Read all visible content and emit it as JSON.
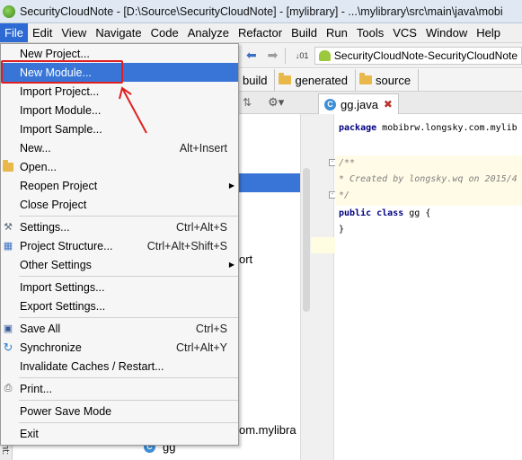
{
  "window": {
    "title": "SecurityCloudNote - [D:\\Source\\SecurityCloudNote] - [mylibrary] - ...\\mylibrary\\src\\main\\java\\mobi"
  },
  "menubar": {
    "items": [
      "File",
      "Edit",
      "View",
      "Navigate",
      "Code",
      "Analyze",
      "Refactor",
      "Build",
      "Run",
      "Tools",
      "VCS",
      "Window",
      "Help"
    ],
    "active": "File"
  },
  "toolbar": {
    "run_config": "SecurityCloudNote-SecurityCloudNote",
    "icons": [
      "back-arrow-icon",
      "forward-arrow-icon",
      "binary-icon",
      "android-icon"
    ]
  },
  "breadcrumb": {
    "items": [
      "build",
      "generated",
      "source"
    ]
  },
  "project": {
    "fragment_port": "ort",
    "fragment_package": "om.mylibra",
    "item_gg": "gg",
    "side_label": "ant:"
  },
  "editor": {
    "tab_label": "gg.java",
    "code": {
      "line1_kw": "package",
      "line1_rest": " mobibrw.longsky.com.mylib",
      "line2": "/**",
      "line3": " * Created by longsky.wq on 2015/4",
      "line4": " */",
      "line5_kw": "public class",
      "line5_rest": " gg {",
      "line6": "}"
    }
  },
  "file_menu": {
    "items": [
      {
        "label": "New Project...",
        "shortcut": "",
        "submenu": false
      },
      {
        "label": "New Module...",
        "shortcut": "",
        "submenu": false,
        "highlighted": true
      },
      {
        "label": "Import Project...",
        "shortcut": "",
        "submenu": false
      },
      {
        "label": "Import Module...",
        "shortcut": "",
        "submenu": false
      },
      {
        "label": "Import Sample...",
        "shortcut": "",
        "submenu": false
      },
      {
        "label": "New...",
        "shortcut": "Alt+Insert",
        "submenu": false
      },
      {
        "label": "Open...",
        "shortcut": "",
        "submenu": false
      },
      {
        "label": "Reopen Project",
        "shortcut": "",
        "submenu": true
      },
      {
        "label": "Close Project",
        "shortcut": "",
        "submenu": false
      },
      {
        "label": "Settings...",
        "shortcut": "Ctrl+Alt+S",
        "submenu": false
      },
      {
        "label": "Project Structure...",
        "shortcut": "Ctrl+Alt+Shift+S",
        "submenu": false
      },
      {
        "label": "Other Settings",
        "shortcut": "",
        "submenu": true
      },
      {
        "label": "Import Settings...",
        "shortcut": "",
        "submenu": false
      },
      {
        "label": "Export Settings...",
        "shortcut": "",
        "submenu": false
      },
      {
        "label": "Save All",
        "shortcut": "Ctrl+S",
        "submenu": false
      },
      {
        "label": "Synchronize",
        "shortcut": "Ctrl+Alt+Y",
        "submenu": false
      },
      {
        "label": "Invalidate Caches / Restart...",
        "shortcut": "",
        "submenu": false
      },
      {
        "label": "Print...",
        "shortcut": "",
        "submenu": false
      },
      {
        "label": "Power Save Mode",
        "shortcut": "",
        "submenu": false
      },
      {
        "label": "Exit",
        "shortcut": "",
        "submenu": false
      }
    ]
  },
  "colors": {
    "menu_highlight": "#3875d7",
    "annotation_red": "#e02020"
  }
}
